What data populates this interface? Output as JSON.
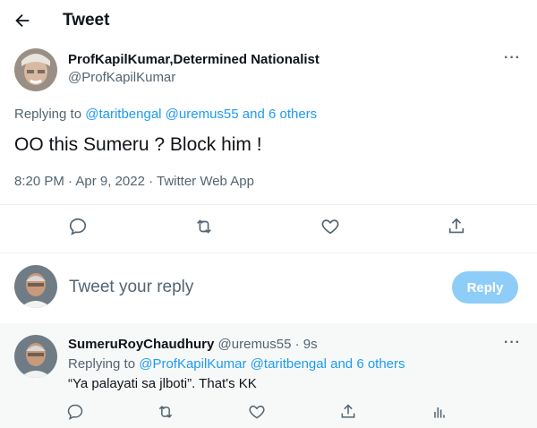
{
  "header": {
    "title": "Tweet"
  },
  "tweet": {
    "author_name": "ProfKapilKumar,Determined Nationalist",
    "author_handle": "@ProfKapilKumar",
    "replying_prefix": "Replying to",
    "replying_to": [
      "@taritbengal",
      "@uremus55"
    ],
    "replying_others": "and 6 others",
    "text": "OO this Sumeru ? Block him !",
    "timestamp": "8:20 PM · Apr 9, 2022 · Twitter Web App"
  },
  "composer": {
    "placeholder": "Tweet your reply",
    "button_label": "Reply"
  },
  "reply": {
    "author_name": "SumeruRoyChaudhury",
    "author_handle": "@uremus55",
    "time": "· 9s",
    "replying_prefix": "Replying to",
    "replying_to": [
      "@ProfKapilKumar",
      "@taritbengal"
    ],
    "replying_others": "and 6 others",
    "text": "“Ya palayati sa jlboti”. That's KK"
  },
  "icons": {
    "back": "arrow-left-icon",
    "more": "more-horizontal-icon",
    "reply": "comment-icon",
    "retweet": "retweet-icon",
    "like": "heart-icon",
    "share": "share-icon",
    "analytics": "analytics-icon"
  },
  "colors": {
    "accent": "#1d9bf0",
    "reply_button_disabled": "#8ecdf8",
    "muted_text": "#536471"
  }
}
